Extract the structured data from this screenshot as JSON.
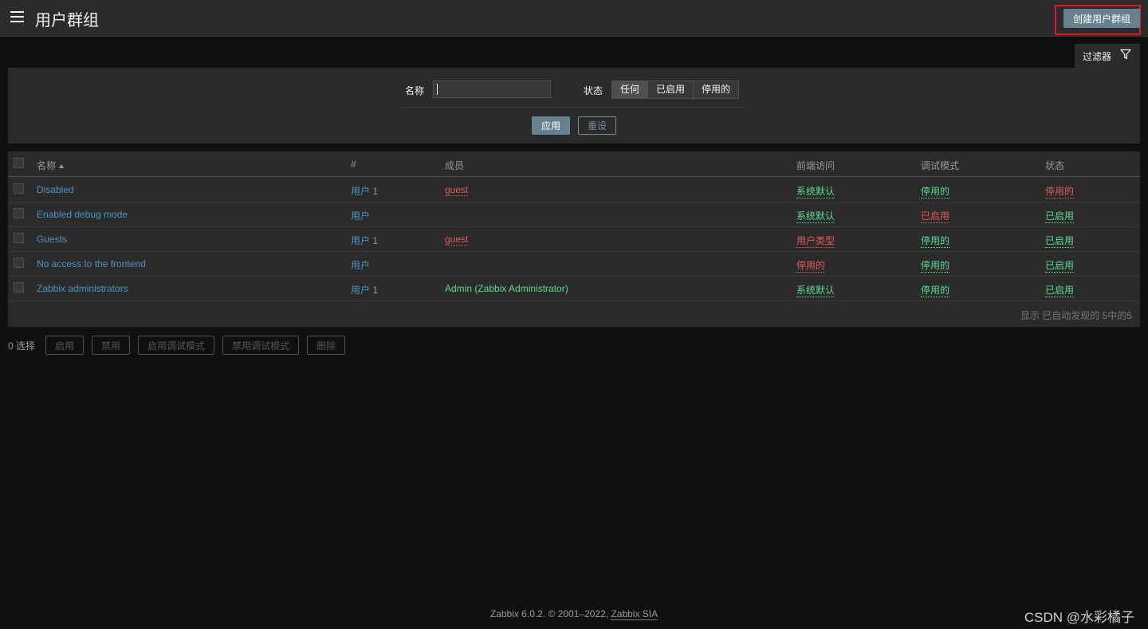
{
  "header": {
    "title": "用户群组",
    "create_button": "创建用户群组"
  },
  "filter": {
    "tab_label": "过滤器",
    "name_label": "名称",
    "name_value": "",
    "status_label": "状态",
    "status_options": [
      "任何",
      "已启用",
      "停用的"
    ],
    "status_selected": "任何",
    "apply_label": "应用",
    "reset_label": "重设"
  },
  "table": {
    "columns": [
      "名称",
      "#",
      "成员",
      "前端访问",
      "调试模式",
      "状态"
    ],
    "sort_column": "名称",
    "rows": [
      {
        "name": "Disabled",
        "users_label": "用户",
        "users_count": "1",
        "members": "guest",
        "members_color": "red",
        "frontend": "系统默认",
        "frontend_color": "green",
        "debug": "停用的",
        "debug_color": "green",
        "status": "停用的",
        "status_color": "red"
      },
      {
        "name": "Enabled debug mode",
        "users_label": "用户",
        "users_count": "",
        "members": "",
        "members_color": "",
        "frontend": "系统默认",
        "frontend_color": "green",
        "debug": "已启用",
        "debug_color": "red",
        "status": "已启用",
        "status_color": "green"
      },
      {
        "name": "Guests",
        "users_label": "用户",
        "users_count": "1",
        "members": "guest",
        "members_color": "red",
        "frontend": "用户类型",
        "frontend_color": "red",
        "debug": "停用的",
        "debug_color": "green",
        "status": "已启用",
        "status_color": "green"
      },
      {
        "name": "No access to the frontend",
        "users_label": "用户",
        "users_count": "",
        "members": "",
        "members_color": "",
        "frontend": "停用的",
        "frontend_color": "red",
        "debug": "停用的",
        "debug_color": "green",
        "status": "已启用",
        "status_color": "green"
      },
      {
        "name": "Zabbix administrators",
        "users_label": "用户",
        "users_count": "1",
        "members": "Admin (Zabbix Administrator)",
        "members_color": "green",
        "frontend": "系统默认",
        "frontend_color": "green",
        "debug": "停用的",
        "debug_color": "green",
        "status": "已启用",
        "status_color": "green"
      }
    ],
    "summary": "显示 已自动发现的 5中的5"
  },
  "bulk_actions": {
    "selected": "0 选择",
    "buttons": [
      "启用",
      "禁用",
      "启用调试模式",
      "禁用调试模式",
      "删除"
    ]
  },
  "footer": {
    "text": "Zabbix 6.0.2. © 2001–2022, ",
    "link": "Zabbix SIA"
  },
  "watermark": "CSDN @水彩橘子",
  "colors": {
    "accent": "#68818f",
    "link": "#4796c4",
    "green": "#59db8f",
    "red": "#e45959",
    "highlight_box": "#e3171d"
  }
}
